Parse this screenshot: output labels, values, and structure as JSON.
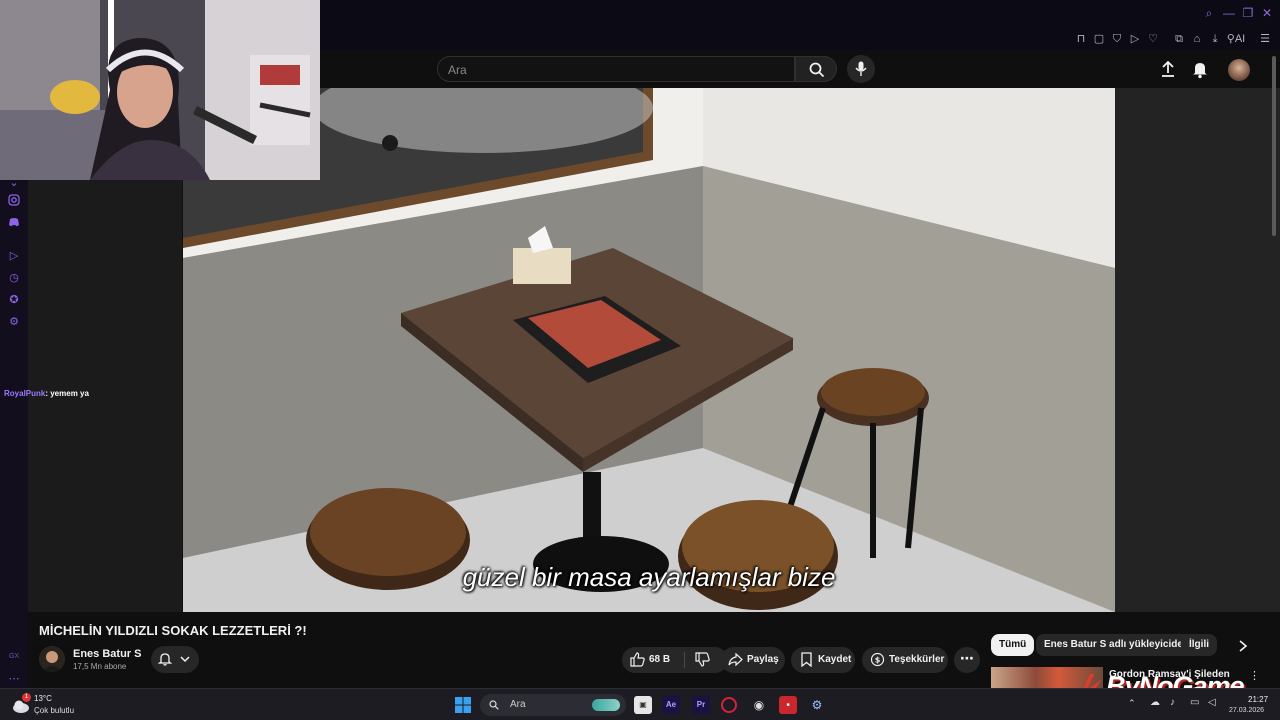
{
  "youtube": {
    "search_placeholder": "Ara",
    "video": {
      "subtitle": "güzel bir masa ayarlamışlar bize",
      "title": "MİCHELİN YILDIZLI SOKAK LEZZETLERİ ?!"
    },
    "channel": {
      "name": "Enes Batur S",
      "subscribers": "17,5 Mn abone"
    },
    "actions": {
      "likes": "68 B",
      "share": "Paylaş",
      "save": "Kaydet",
      "thanks": "Teşekkürler"
    },
    "chips": [
      "Tümü",
      "Enes Batur S adlı yükleyiciden",
      "İlgili"
    ],
    "recommendation_title": "Gordon Ramsay'i Şileden"
  },
  "chat": {
    "user": "RoyalPunk",
    "message": ": yemem ya"
  },
  "sidebar": {
    "gx_label": "GX"
  },
  "browser": {
    "ai_label": "AI"
  },
  "taskbar": {
    "weather_temp": "13°C",
    "weather_desc": "Çok bulutlu",
    "search_label": "Ara",
    "notification_count": "1",
    "time": "21:27",
    "date": "27.03.2026"
  },
  "watermark": "ByNoGame",
  "colors": {
    "accent": "#8e63e8",
    "youtube_bg": "#0f0f0f",
    "chat_user": "#9b7bff"
  }
}
